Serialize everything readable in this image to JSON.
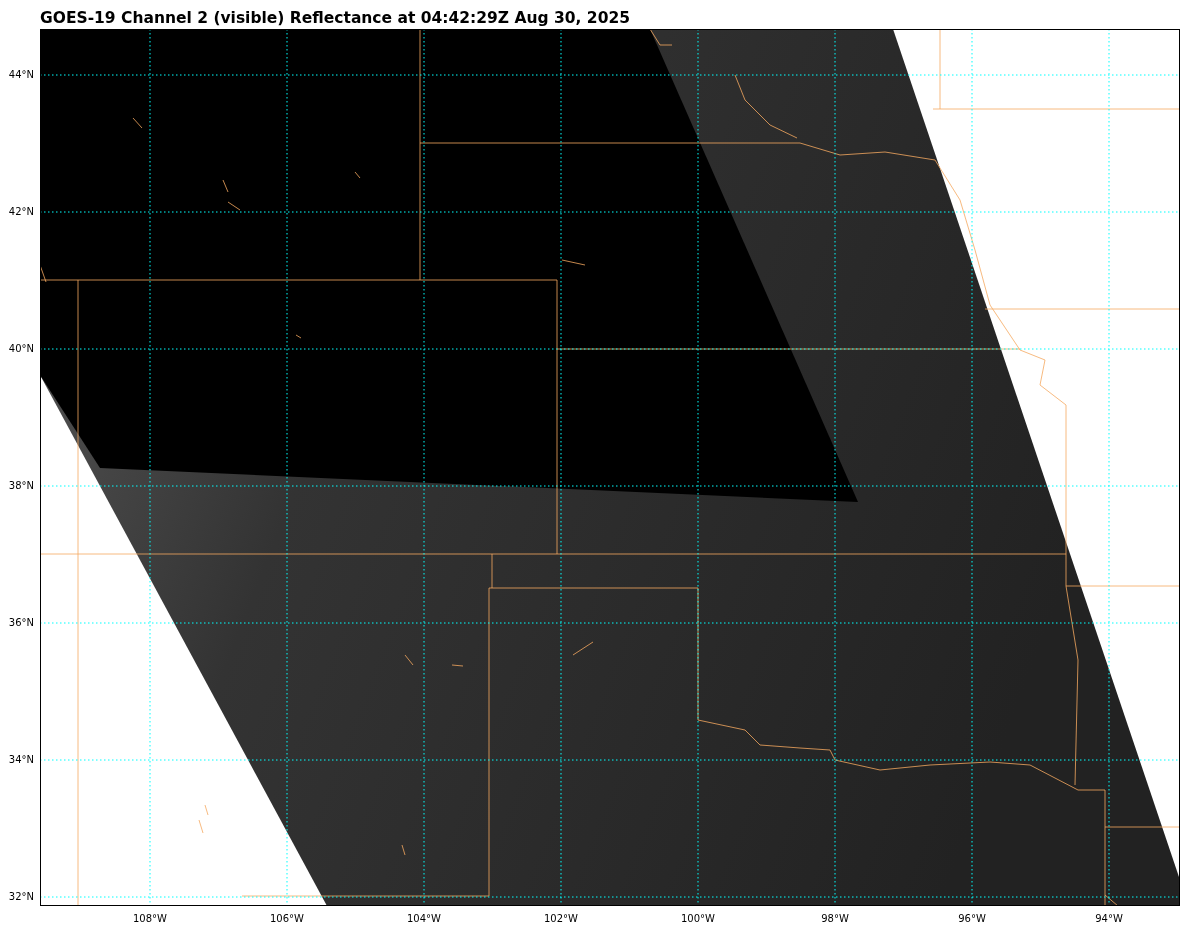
{
  "title": "GOES-19 Channel 2 (visible) Reflectance at 04:42:29Z Aug 30, 2025",
  "map": {
    "latitude_labels": [
      "44°N",
      "42°N",
      "40°N",
      "38°N",
      "36°N",
      "34°N",
      "32°N"
    ],
    "longitude_labels": [
      "108°W",
      "106°W",
      "104°W",
      "102°W",
      "100°W",
      "98°W",
      "96°W",
      "94°W"
    ]
  }
}
